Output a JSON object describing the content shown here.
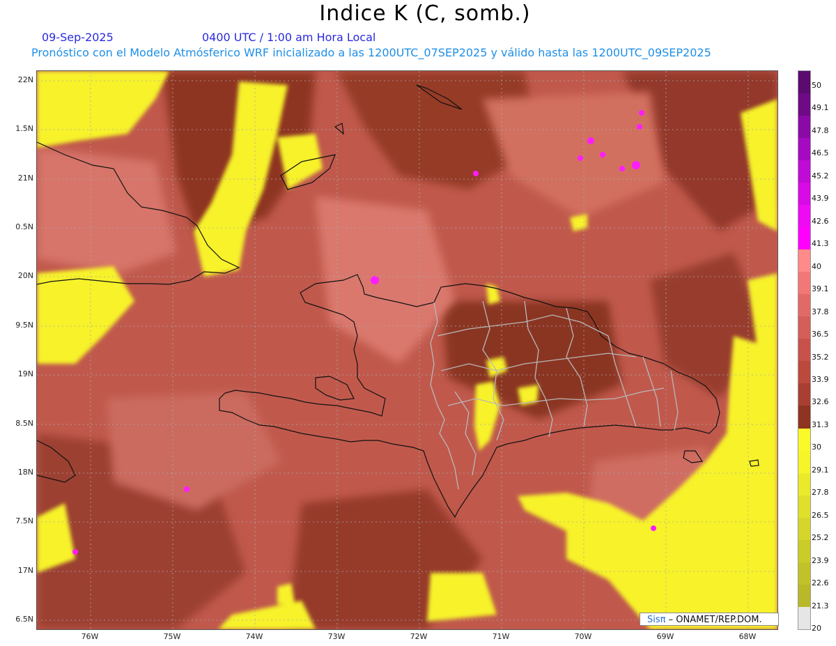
{
  "header": {
    "title": "Indice K (C, somb.)",
    "date": "09-Sep-2025",
    "time": "0400 UTC / 1:00 am Hora Local",
    "subtitle": "Pronóstico con el Modelo Atmósferico WRF inicializado a las 1200UTC_07SEP2025 y válido hasta las  1200UTC_09SEP2025"
  },
  "axes": {
    "lat_labels": [
      "22N",
      "1.5N",
      "21N",
      "0.5N",
      "20N",
      "9.5N",
      "19N",
      "8.5N",
      "18N",
      "7.5N",
      "17N",
      "6.5N"
    ],
    "lon_labels": [
      "76W",
      "75W",
      "74W",
      "73W",
      "72W",
      "71W",
      "70W",
      "69W",
      "68W"
    ],
    "lat_range": [
      16.5,
      22.2
    ],
    "lon_range": [
      -76.7,
      -67.6
    ],
    "grid": true
  },
  "colorbar": {
    "labels": [
      "50",
      "49.1",
      "47.8",
      "46.5",
      "45.2",
      "43.9",
      "42.6",
      "41.3",
      "40",
      "39.1",
      "37.8",
      "36.5",
      "35.2",
      "33.9",
      "32.6",
      "31.3",
      "30",
      "29.1",
      "27.8",
      "26.5",
      "25.2",
      "23.9",
      "22.6",
      "21.3",
      "20"
    ],
    "colors": [
      "#5b0a6e",
      "#6e0a86",
      "#8a0aa6",
      "#a50ac0",
      "#c00ad6",
      "#d80ae6",
      "#ee0af2",
      "#ff00ff",
      "#ff8a8a",
      "#f27878",
      "#e26a66",
      "#d45e58",
      "#c8524a",
      "#bb4a3d",
      "#a83f31",
      "#8e3420",
      "#fafa2a",
      "#f5f52a",
      "#eaea2a",
      "#e0e02a",
      "#d6d62a",
      "#cccc28",
      "#c2c228",
      "#b8b828",
      "#e6e6e6"
    ]
  },
  "credit": {
    "logo": "Sisπ",
    "text": " – ONAMET/REP.DOM."
  }
}
